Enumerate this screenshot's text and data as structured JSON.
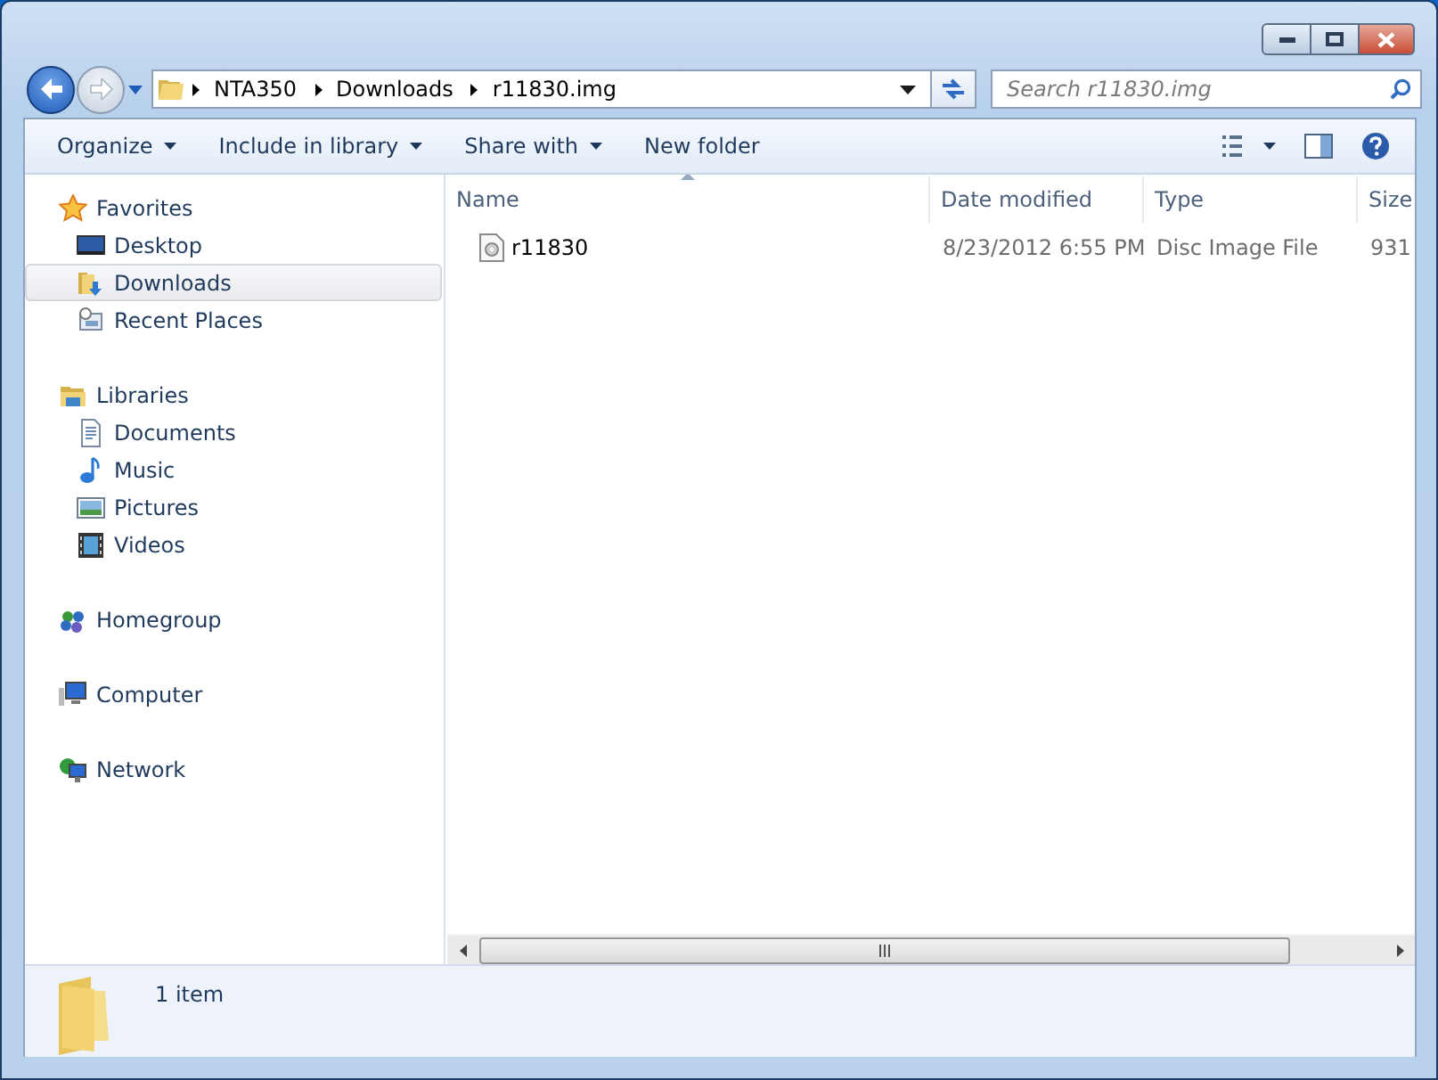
{
  "address": {
    "crumbs": [
      "NTA350",
      "Downloads",
      "r11830.img"
    ]
  },
  "search": {
    "placeholder": "Search r11830.img"
  },
  "toolbar": [
    {
      "label": "Organize",
      "has_menu": true
    },
    {
      "label": "Include in library",
      "has_menu": true
    },
    {
      "label": "Share with",
      "has_menu": true
    },
    {
      "label": "New folder",
      "has_menu": false
    }
  ],
  "sidebar": [
    {
      "label": "Favorites",
      "items": [
        {
          "label": "Desktop",
          "selected": false
        },
        {
          "label": "Downloads",
          "selected": true
        },
        {
          "label": "Recent Places",
          "selected": false
        }
      ]
    },
    {
      "label": "Libraries",
      "items": [
        {
          "label": "Documents",
          "selected": false
        },
        {
          "label": "Music",
          "selected": false
        },
        {
          "label": "Pictures",
          "selected": false
        },
        {
          "label": "Videos",
          "selected": false
        }
      ]
    },
    {
      "label": "Homegroup"
    },
    {
      "label": "Computer"
    },
    {
      "label": "Network"
    }
  ],
  "table": {
    "columns": [
      {
        "label": "Name",
        "sorted": true
      },
      {
        "label": "Date modified",
        "sorted": false
      },
      {
        "label": "Type",
        "sorted": false
      },
      {
        "label": "Size",
        "sorted": false
      }
    ],
    "rows": [
      {
        "cells": [
          "r11830",
          "8/23/2012 6:55 PM",
          "Disc Image File",
          "931"
        ],
        "selected": false
      }
    ]
  },
  "details": {
    "summary": "1 item"
  }
}
